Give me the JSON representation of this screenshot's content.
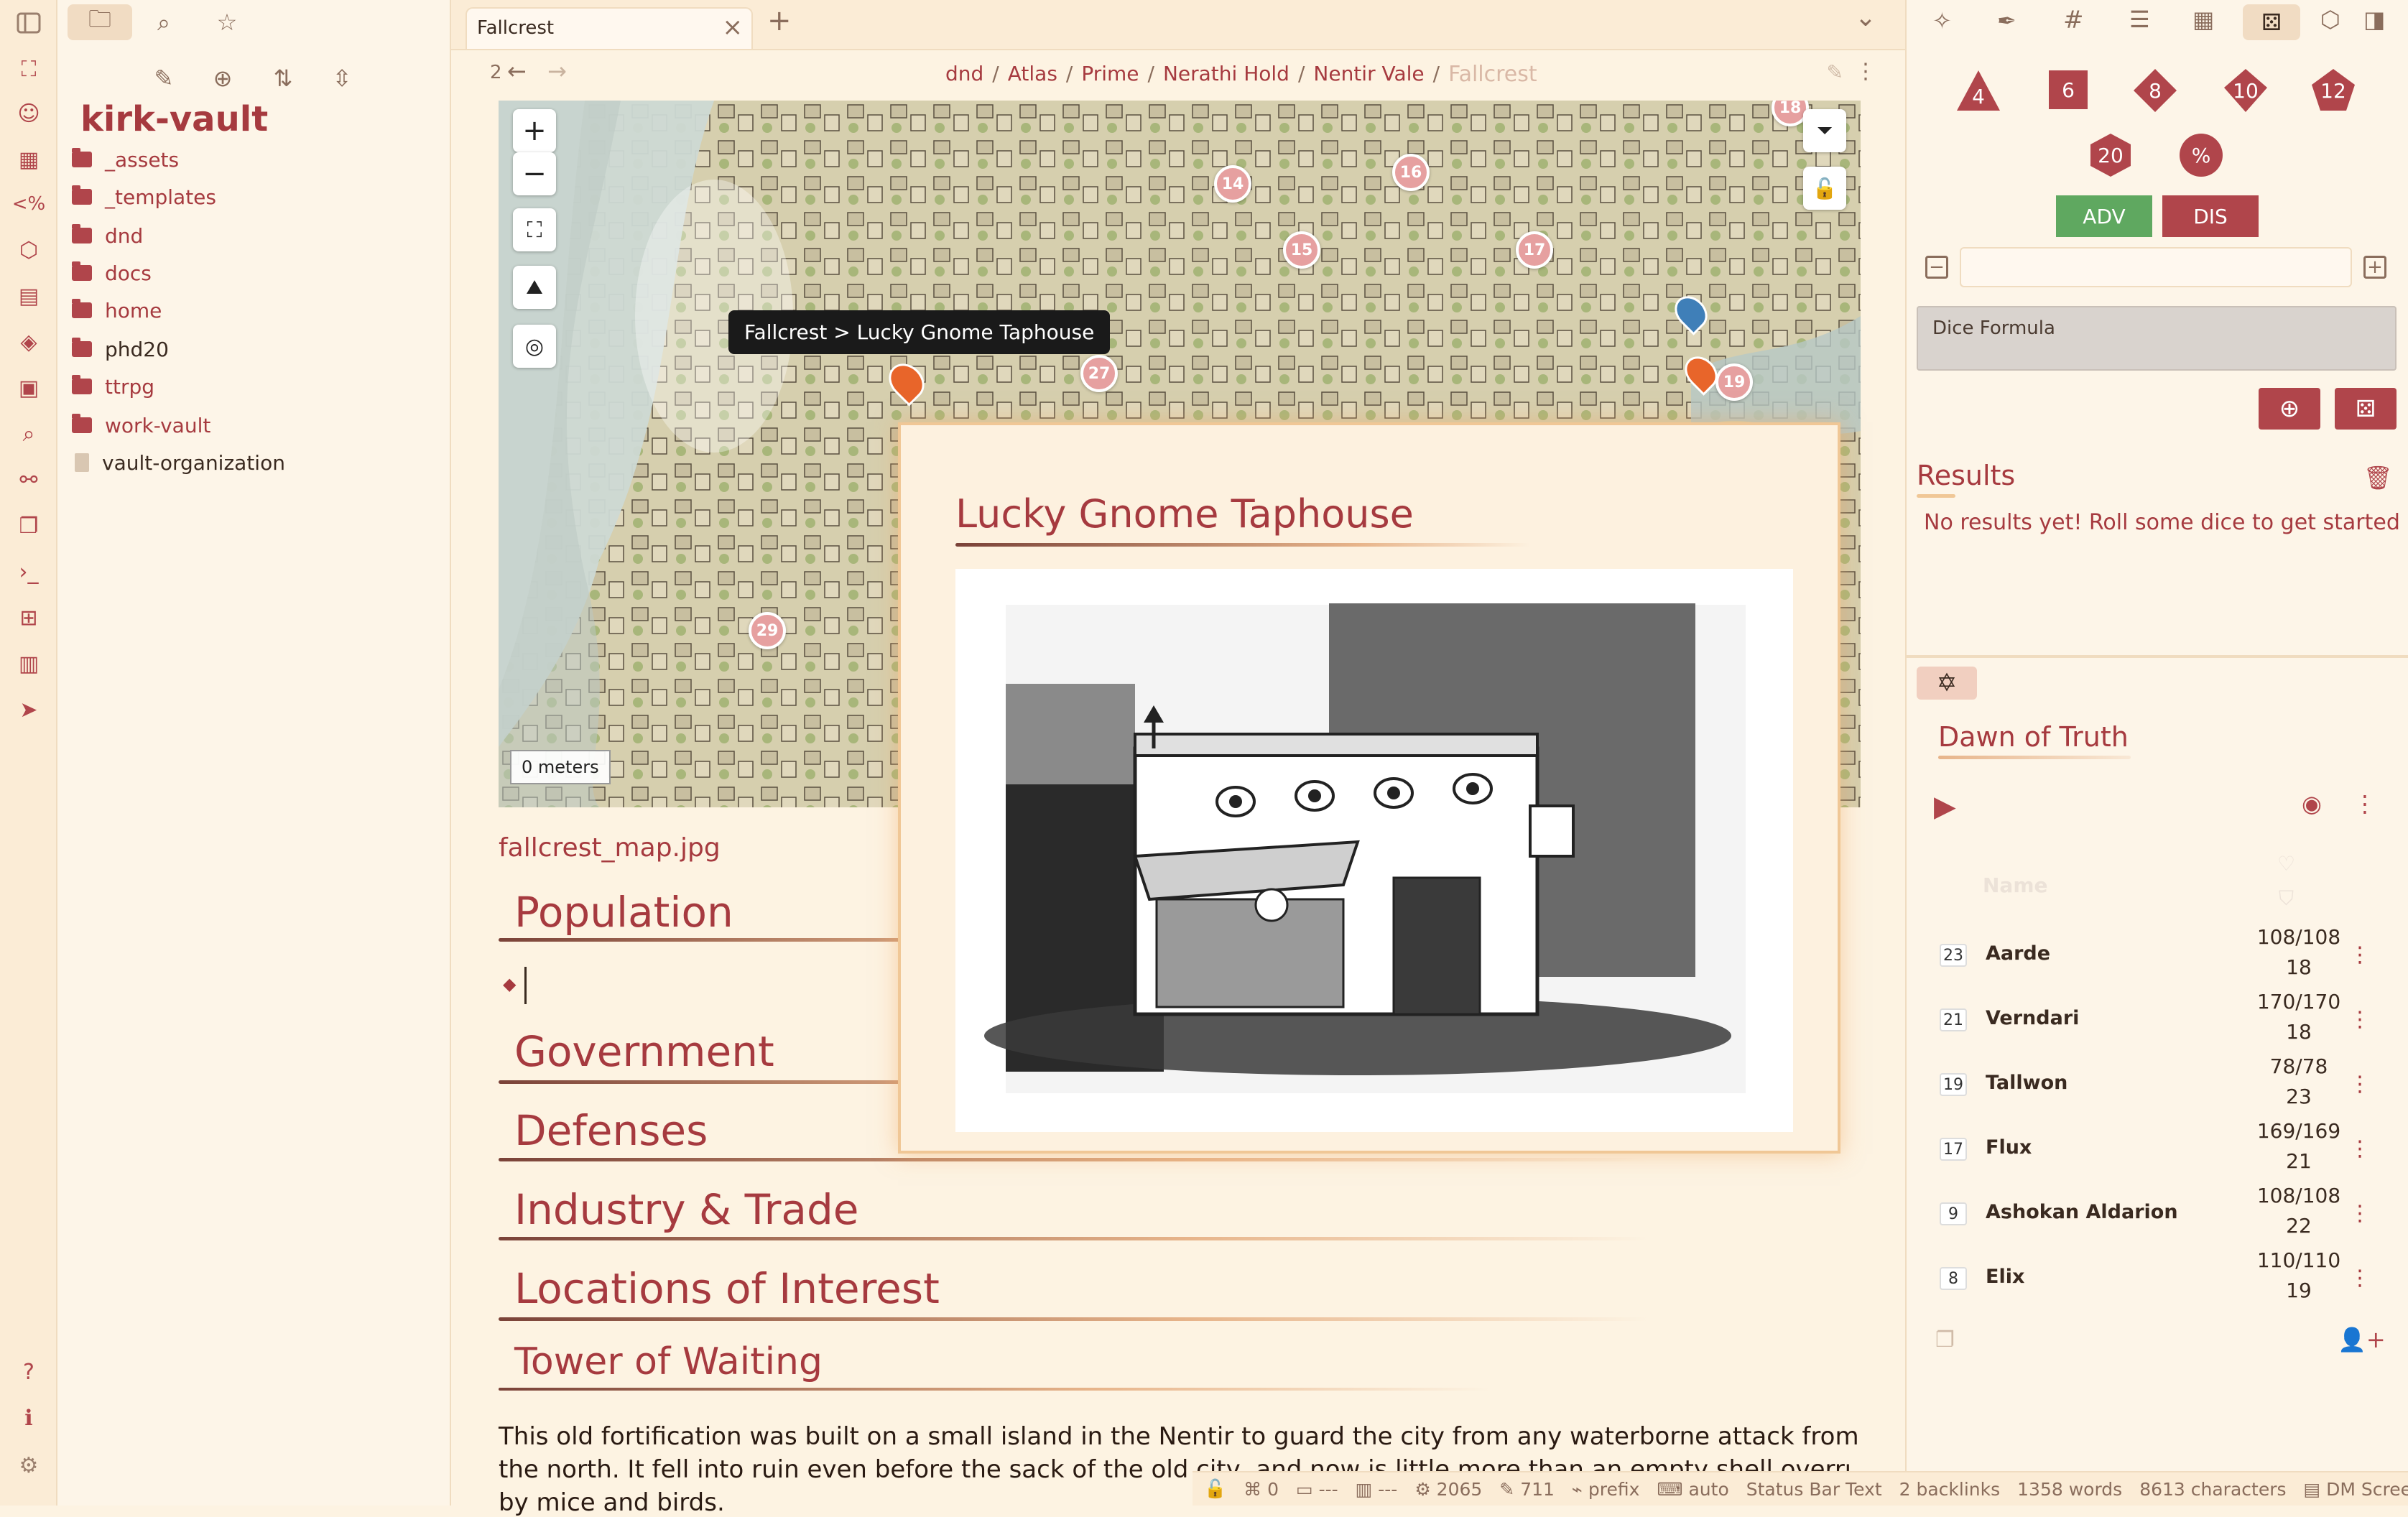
{
  "ribbon": {
    "icons": [
      "sidebar-toggle-icon",
      "map-icon",
      "smiley-icon",
      "calendar-icon",
      "percent-code-icon",
      "dice-shape-icon",
      "table-icon",
      "cube-icon",
      "layout-icon",
      "file-search-icon",
      "graph-icon",
      "copy-icon",
      "terminal-icon",
      "puzzle-icon",
      "columns-icon",
      "send-icon",
      "help-icon",
      "info-icon",
      "settings-icon"
    ]
  },
  "left_sidebar": {
    "vault_name": "kirk-vault",
    "tree": [
      {
        "label": "_assets",
        "type": "folder"
      },
      {
        "label": "_templates",
        "type": "folder"
      },
      {
        "label": "dnd",
        "type": "folder"
      },
      {
        "label": "docs",
        "type": "folder"
      },
      {
        "label": "home",
        "type": "folder"
      },
      {
        "label": "phd20",
        "type": "folder"
      },
      {
        "label": "ttrpg",
        "type": "folder"
      },
      {
        "label": "work-vault",
        "type": "folder"
      },
      {
        "label": "vault-organization",
        "type": "file"
      }
    ]
  },
  "tabs": {
    "active": "Fallcrest",
    "close": "×",
    "new": "+",
    "dropdown": "⌄"
  },
  "nav": {
    "back_count": "2",
    "breadcrumb": [
      "dnd",
      "Atlas",
      "Prime",
      "Nerathi Hold",
      "Nentir Vale"
    ],
    "current": "Fallcrest"
  },
  "map": {
    "markers": [
      "14",
      "15",
      "16",
      "17",
      "18",
      "19",
      "27",
      "29"
    ],
    "tooltip": "Fallcrest > Lucky Gnome Taphouse",
    "scale": "0 meters",
    "zoom_in": "+",
    "zoom_out": "−",
    "caption": "fallcrest_map.jpg"
  },
  "note": {
    "headings": [
      "Population",
      "Government",
      "Defenses",
      "Industry & Trade",
      "Locations of Interest",
      "Tower of Waiting"
    ],
    "list_bullet": "◆",
    "paragraph_a": "This old fortification was built on a small island in the Nentir to guard the city from any waterborne attack from",
    "paragraph_b": "the north. It fell into ruin even before the sack of the old city, and now is little more than an empty shell overrun",
    "paragraph_c": "by mice and birds."
  },
  "popover": {
    "title": "Lucky Gnome Taphouse"
  },
  "dice_roller": {
    "dice": [
      "4",
      "6",
      "8",
      "10",
      "12",
      "20",
      "%"
    ],
    "adv": "ADV",
    "dis": "DIS",
    "formula_placeholder": "Dice Formula",
    "results_title": "Results",
    "results_empty": "No results yet! Roll some dice to get started :)"
  },
  "initiative": {
    "encounter": "Dawn of Truth",
    "name_header": "Name",
    "rows": [
      {
        "init": "23",
        "name": "Aarde",
        "hp": "108/108",
        "ac": "18"
      },
      {
        "init": "21",
        "name": "Verndari",
        "hp": "170/170",
        "ac": "18"
      },
      {
        "init": "19",
        "name": "Tallwon",
        "hp": "78/78",
        "ac": "23"
      },
      {
        "init": "17",
        "name": "Flux",
        "hp": "169/169",
        "ac": "21"
      },
      {
        "init": "9",
        "name": "Ashokan Aldarion",
        "hp": "108/108",
        "ac": "22"
      },
      {
        "init": "8",
        "name": "Elix",
        "hp": "110/110",
        "ac": "19"
      }
    ]
  },
  "status_bar": {
    "a": "0",
    "b": "---",
    "c": "---",
    "d": "2065",
    "e": "711",
    "f": "prefix",
    "g": "auto",
    "text": "Status Bar Text",
    "backlinks": "2 backlinks",
    "words": "1358 words",
    "chars": "8613 characters",
    "dm": "DM Screen"
  },
  "colors": {
    "accent": "#a63a3f",
    "background": "#fdf3e2",
    "adv": "#5fa860",
    "dis": "#b0454b"
  }
}
